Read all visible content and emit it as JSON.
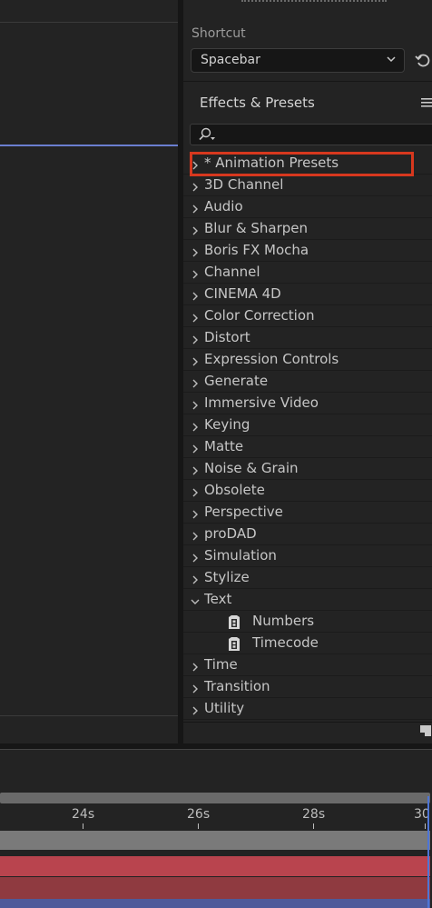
{
  "shortcut": {
    "label": "Shortcut",
    "value": "Spacebar"
  },
  "effects_panel": {
    "title": "Effects & Presets",
    "search_placeholder": ""
  },
  "tree": [
    {
      "label": "* Animation Presets",
      "expanded": false,
      "highlighted": true
    },
    {
      "label": "3D Channel",
      "expanded": false
    },
    {
      "label": "Audio",
      "expanded": false
    },
    {
      "label": "Blur & Sharpen",
      "expanded": false
    },
    {
      "label": "Boris FX Mocha",
      "expanded": false
    },
    {
      "label": "Channel",
      "expanded": false
    },
    {
      "label": "CINEMA 4D",
      "expanded": false
    },
    {
      "label": "Color Correction",
      "expanded": false
    },
    {
      "label": "Distort",
      "expanded": false
    },
    {
      "label": "Expression Controls",
      "expanded": false
    },
    {
      "label": "Generate",
      "expanded": false
    },
    {
      "label": "Immersive Video",
      "expanded": false
    },
    {
      "label": "Keying",
      "expanded": false
    },
    {
      "label": "Matte",
      "expanded": false
    },
    {
      "label": "Noise & Grain",
      "expanded": false
    },
    {
      "label": "Obsolete",
      "expanded": false
    },
    {
      "label": "Perspective",
      "expanded": false
    },
    {
      "label": "proDAD",
      "expanded": false
    },
    {
      "label": "Simulation",
      "expanded": false
    },
    {
      "label": "Stylize",
      "expanded": false
    },
    {
      "label": "Text",
      "expanded": true,
      "children": [
        "Numbers",
        "Timecode"
      ]
    },
    {
      "label": "Time",
      "expanded": false
    },
    {
      "label": "Transition",
      "expanded": false
    },
    {
      "label": "Utility",
      "expanded": false
    }
  ],
  "timeline": {
    "ticks": [
      "24s",
      "26s",
      "28s",
      "30"
    ]
  },
  "colors": {
    "highlight_box": "#d7381e",
    "cti": "#4d75d6",
    "layer_red": "#b9444e"
  }
}
